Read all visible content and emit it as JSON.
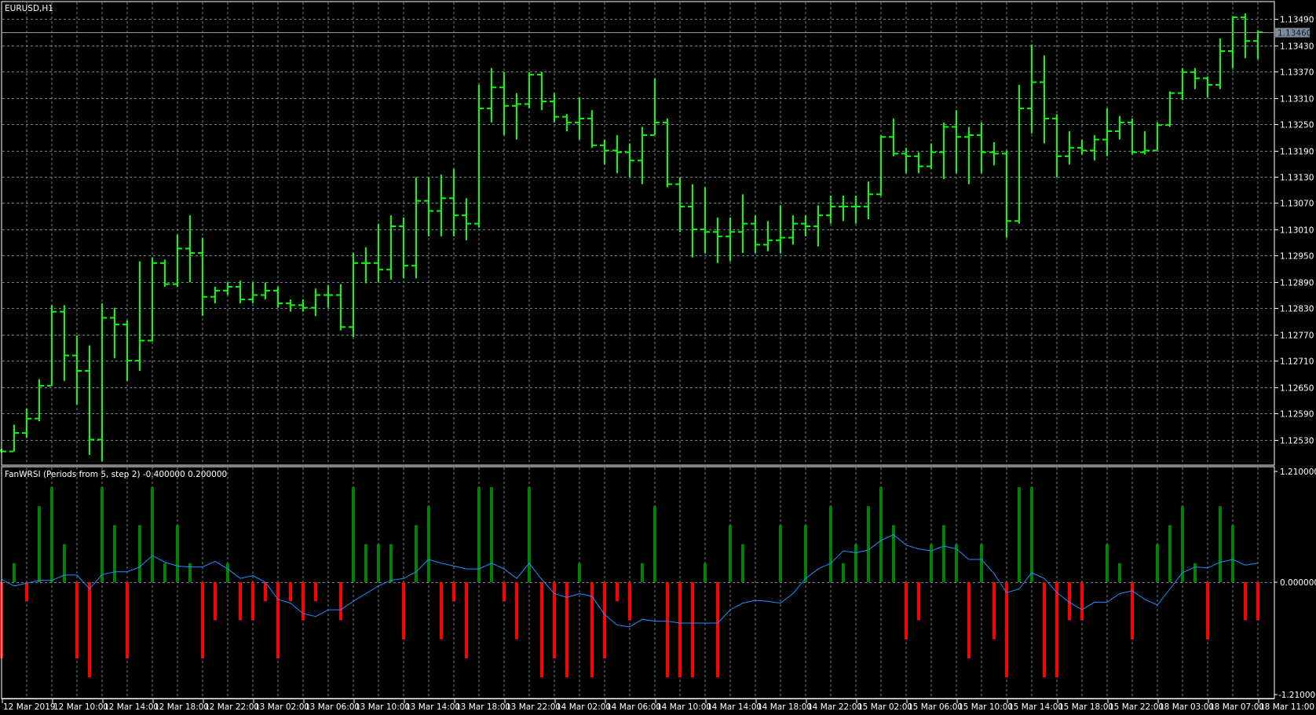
{
  "main_panel": {
    "title": "EURUSD,H1",
    "current_price": "1.13460",
    "current_price_value": 1.1346,
    "price_ticks": [
      "1.13490",
      "1.13430",
      "1.13370",
      "1.13310",
      "1.13250",
      "1.13190",
      "1.13130",
      "1.13070",
      "1.13010",
      "1.12950",
      "1.12890",
      "1.12830",
      "1.12770",
      "1.12710",
      "1.12650",
      "1.12590",
      "1.12530"
    ]
  },
  "indicator_panel": {
    "title": "FanWRSI (Periods from 5, step 2) -0.400000 0.200000",
    "scale_labels": {
      "top": "1.210000",
      "zero": "0.000000",
      "bottom": "-1.210000"
    },
    "ylim": [
      -1.21,
      1.21
    ]
  },
  "time_axis": {
    "labels": [
      "12 Mar 2019",
      "12 Mar 10:00",
      "12 Mar 14:00",
      "12 Mar 18:00",
      "12 Mar 22:00",
      "13 Mar 02:00",
      "13 Mar 06:00",
      "13 Mar 10:00",
      "13 Mar 14:00",
      "13 Mar 18:00",
      "13 Mar 22:00",
      "14 Mar 02:00",
      "14 Mar 06:00",
      "14 Mar 10:00",
      "14 Mar 14:00",
      "14 Mar 18:00",
      "14 Mar 22:00",
      "15 Mar 02:00",
      "15 Mar 06:00",
      "15 Mar 10:00",
      "15 Mar 14:00",
      "15 Mar 18:00",
      "15 Mar 22:00",
      "18 Mar 03:00",
      "18 Mar 07:00",
      "18 Mar 11:00"
    ],
    "bars_per_label": 4
  },
  "colors": {
    "background": "#000000",
    "bar": "#00ff00",
    "grid": "#6f7f94",
    "hist_up": "#008000",
    "hist_down": "#ff0000",
    "signal_line": "#1e90ff",
    "frame": "#ffffff",
    "price_label_bg": "#7d8b99"
  },
  "chart_data": [
    {
      "type": "ohlc",
      "title": "EURUSD,H1",
      "fields": [
        "open",
        "high",
        "low",
        "close"
      ],
      "ylim": [
        1.125,
        1.1352
      ],
      "bars": [
        [
          1.12505,
          1.12509,
          1.125,
          1.12503
        ],
        [
          1.12503,
          1.12564,
          1.12503,
          1.12545
        ],
        [
          1.12545,
          1.12601,
          1.12534,
          1.12578
        ],
        [
          1.12578,
          1.12668,
          1.12572,
          1.12653
        ],
        [
          1.12653,
          1.12837,
          1.12653,
          1.12822
        ],
        [
          1.12822,
          1.12837,
          1.12664,
          1.12722
        ],
        [
          1.12722,
          1.12768,
          1.1261,
          1.12687
        ],
        [
          1.12687,
          1.12745,
          1.12495,
          1.1253
        ],
        [
          1.1253,
          1.12841,
          1.1248,
          1.12808
        ],
        [
          1.12808,
          1.12831,
          1.12716,
          1.12793
        ],
        [
          1.12793,
          1.12802,
          1.12664,
          1.1271
        ],
        [
          1.1271,
          1.12937,
          1.12687,
          1.12756
        ],
        [
          1.12756,
          1.12946,
          1.12754,
          1.12933
        ],
        [
          1.12933,
          1.12941,
          1.12879,
          1.12885
        ],
        [
          1.12885,
          1.12998,
          1.12879,
          1.12966
        ],
        [
          1.12966,
          1.13042,
          1.12889,
          1.12956
        ],
        [
          1.12956,
          1.12991,
          1.12812,
          1.12856
        ],
        [
          1.12856,
          1.12879,
          1.12841,
          1.1287
        ],
        [
          1.1287,
          1.12889,
          1.1286,
          1.12879
        ],
        [
          1.12879,
          1.12893,
          1.12841,
          1.1285
        ],
        [
          1.1285,
          1.12889,
          1.12841,
          1.1286
        ],
        [
          1.1286,
          1.12889,
          1.1285,
          1.1287
        ],
        [
          1.1287,
          1.12879,
          1.12831,
          1.12841
        ],
        [
          1.12841,
          1.1285,
          1.12822,
          1.12837
        ],
        [
          1.12837,
          1.1285,
          1.12822,
          1.12831
        ],
        [
          1.12831,
          1.12875,
          1.12812,
          1.1286
        ],
        [
          1.1286,
          1.12883,
          1.12831,
          1.1286
        ],
        [
          1.1286,
          1.12885,
          1.12779,
          1.12787
        ],
        [
          1.12787,
          1.12956,
          1.12764,
          1.12933
        ],
        [
          1.12933,
          1.12969,
          1.12887,
          1.12933
        ],
        [
          1.12933,
          1.13023,
          1.12889,
          1.12918
        ],
        [
          1.12918,
          1.13042,
          1.12895,
          1.13017
        ],
        [
          1.13017,
          1.13037,
          1.12898,
          1.12927
        ],
        [
          1.12927,
          1.13129,
          1.12898,
          1.13075
        ],
        [
          1.13075,
          1.13129,
          1.12994,
          1.13052
        ],
        [
          1.13052,
          1.13135,
          1.12994,
          1.13081
        ],
        [
          1.13081,
          1.13148,
          1.12994,
          1.13042
        ],
        [
          1.13042,
          1.13081,
          1.12985,
          1.13023
        ],
        [
          1.13023,
          1.1334,
          1.13014,
          1.13286
        ],
        [
          1.13286,
          1.13378,
          1.13254,
          1.13334
        ],
        [
          1.13334,
          1.13369,
          1.13225,
          1.13292
        ],
        [
          1.13292,
          1.13321,
          1.13215,
          1.13296
        ],
        [
          1.13296,
          1.13369,
          1.13286,
          1.13363
        ],
        [
          1.13363,
          1.13369,
          1.13282,
          1.13302
        ],
        [
          1.13302,
          1.13321,
          1.13254,
          1.13267
        ],
        [
          1.13267,
          1.13273,
          1.13234,
          1.13254
        ],
        [
          1.13254,
          1.13311,
          1.13215,
          1.13263
        ],
        [
          1.13263,
          1.13282,
          1.13196,
          1.13202
        ],
        [
          1.13202,
          1.13215,
          1.13158,
          1.1319
        ],
        [
          1.1319,
          1.13225,
          1.13138,
          1.13186
        ],
        [
          1.13186,
          1.13206,
          1.13129,
          1.13167
        ],
        [
          1.13167,
          1.13244,
          1.13113,
          1.13225
        ],
        [
          1.13225,
          1.13355,
          1.13225,
          1.13254
        ],
        [
          1.13254,
          1.13263,
          1.13106,
          1.13113
        ],
        [
          1.13113,
          1.13129,
          1.13004,
          1.13062
        ],
        [
          1.13062,
          1.13113,
          1.12946,
          1.1301
        ],
        [
          1.1301,
          1.13106,
          1.12956,
          1.13004
        ],
        [
          1.13004,
          1.13037,
          1.12933,
          1.12994
        ],
        [
          1.12994,
          1.13037,
          1.12937,
          1.13004
        ],
        [
          1.13004,
          1.1309,
          1.12956,
          1.13023
        ],
        [
          1.13023,
          1.13042,
          1.12956,
          1.12975
        ],
        [
          1.12975,
          1.13029,
          1.1296,
          1.12985
        ],
        [
          1.12985,
          1.13065,
          1.12956,
          1.12991
        ],
        [
          1.12991,
          1.13042,
          1.12975,
          1.13023
        ],
        [
          1.13023,
          1.13042,
          1.12994,
          1.13017
        ],
        [
          1.13017,
          1.13065,
          1.12971,
          1.13042
        ],
        [
          1.13042,
          1.13087,
          1.13023,
          1.13062
        ],
        [
          1.13062,
          1.13087,
          1.13029,
          1.13062
        ],
        [
          1.13062,
          1.13087,
          1.13023,
          1.13062
        ],
        [
          1.13062,
          1.13119,
          1.13033,
          1.1309
        ],
        [
          1.1309,
          1.13225,
          1.13087,
          1.13221
        ],
        [
          1.13221,
          1.13263,
          1.13177,
          1.13183
        ],
        [
          1.13183,
          1.13196,
          1.13138,
          1.13177
        ],
        [
          1.13177,
          1.13186,
          1.13138,
          1.13154
        ],
        [
          1.13154,
          1.13206,
          1.13148,
          1.13186
        ],
        [
          1.13186,
          1.13254,
          1.13125,
          1.13244
        ],
        [
          1.13244,
          1.13282,
          1.13138,
          1.13221
        ],
        [
          1.13221,
          1.13244,
          1.13113,
          1.13225
        ],
        [
          1.13225,
          1.13254,
          1.13138,
          1.13186
        ],
        [
          1.13186,
          1.13209,
          1.13156,
          1.13183
        ],
        [
          1.13183,
          1.1319,
          1.12991,
          1.13029
        ],
        [
          1.13029,
          1.1334,
          1.13023,
          1.13286
        ],
        [
          1.13286,
          1.13432,
          1.13229,
          1.13346
        ],
        [
          1.13346,
          1.13407,
          1.13206,
          1.13263
        ],
        [
          1.13263,
          1.13273,
          1.13129,
          1.13177
        ],
        [
          1.13177,
          1.13234,
          1.13158,
          1.13196
        ],
        [
          1.13196,
          1.13215,
          1.13181,
          1.1319
        ],
        [
          1.1319,
          1.13225,
          1.13167,
          1.13215
        ],
        [
          1.13215,
          1.13286,
          1.13177,
          1.13234
        ],
        [
          1.13234,
          1.13269,
          1.13215,
          1.13254
        ],
        [
          1.13254,
          1.13263,
          1.13181,
          1.13186
        ],
        [
          1.13186,
          1.13234,
          1.13181,
          1.1319
        ],
        [
          1.1319,
          1.13254,
          1.1319,
          1.13248
        ],
        [
          1.13248,
          1.13325,
          1.13244,
          1.13321
        ],
        [
          1.13321,
          1.13378,
          1.13305,
          1.13369
        ],
        [
          1.13369,
          1.13378,
          1.1333,
          1.13355
        ],
        [
          1.13355,
          1.13359,
          1.13311,
          1.1334
        ],
        [
          1.1334,
          1.13446,
          1.1333,
          1.13417
        ],
        [
          1.13417,
          1.13497,
          1.13378,
          1.13494
        ],
        [
          1.13494,
          1.13503,
          1.13401,
          1.1344
        ],
        [
          1.1344,
          1.13465,
          1.13398,
          1.1346
        ]
      ]
    },
    {
      "type": "bar",
      "title": "FanWRSI (Periods from 5, step 2) -0.400000 0.200000",
      "ylim": [
        -1.21,
        1.21
      ],
      "series": [
        {
          "name": "histogram",
          "values": [
            -0.8,
            0.2,
            -0.2,
            0.8,
            1,
            0.4,
            -0.8,
            -1,
            1,
            0.6,
            -0.8,
            0.6,
            1,
            0.2,
            0.6,
            0.2,
            -0.8,
            -0.4,
            0.2,
            -0.4,
            -0.4,
            -0.2,
            -0.8,
            -0.2,
            -0.4,
            -0.2,
            0,
            -0.4,
            1,
            0.4,
            0.4,
            0.4,
            -0.6,
            0.6,
            0.8,
            -0.6,
            -0.2,
            -0.8,
            1,
            1,
            -0.2,
            -0.6,
            1,
            -1,
            -0.8,
            -1,
            0.2,
            -1,
            -0.8,
            -0.2,
            -0.4,
            0.2,
            0.8,
            -1,
            -1,
            -1,
            0.2,
            -1,
            0.6,
            0.4,
            0,
            0,
            0.6,
            0,
            0.6,
            0,
            0.8,
            0.2,
            0.4,
            0.8,
            1,
            0.6,
            -0.6,
            -0.4,
            0.4,
            0.6,
            0.4,
            -0.8,
            0.4,
            -0.6,
            -1,
            1,
            1,
            -1,
            -1,
            -0.4,
            -0.4,
            0,
            0.4,
            0.2,
            -0.6,
            0,
            0.4,
            0.6,
            0.8,
            0.2,
            -0.6,
            0.8,
            0.6,
            -0.4,
            -0.4
          ]
        },
        {
          "name": "signal",
          "type": "line",
          "values": [
            0.03,
            -0.04,
            -0.01,
            0.02,
            0.02,
            0.075,
            0.075,
            -0.07,
            0.08,
            0.11,
            0.11,
            0.16,
            0.28,
            0.21,
            0.17,
            0.16,
            0.16,
            0.22,
            0.14,
            0.04,
            0.07,
            0,
            -0.18,
            -0.22,
            -0.33,
            -0.36,
            -0.29,
            -0.29,
            -0.2,
            -0.12,
            -0.04,
            0.02,
            0.04,
            0.11,
            0.24,
            0.2,
            0.17,
            0.14,
            0.14,
            0.2,
            0.14,
            0.04,
            0.2,
            0.03,
            -0.12,
            -0.16,
            -0.12,
            -0.15,
            -0.34,
            -0.45,
            -0.47,
            -0.39,
            -0.41,
            -0.41,
            -0.43,
            -0.43,
            -0.43,
            -0.43,
            -0.29,
            -0.22,
            -0.19,
            -0.2,
            -0.22,
            -0.12,
            0.04,
            0.14,
            0.2,
            0.33,
            0.31,
            0.34,
            0.44,
            0.5,
            0.39,
            0.35,
            0.33,
            0.38,
            0.35,
            0.24,
            0.24,
            0.09,
            -0.11,
            -0.07,
            0.1,
            0.04,
            -0.11,
            -0.21,
            -0.29,
            -0.21,
            -0.21,
            -0.12,
            -0.09,
            -0.18,
            -0.24,
            -0.07,
            0.1,
            0.16,
            0.15,
            0.21,
            0.24,
            0.18,
            0.2
          ]
        }
      ]
    }
  ]
}
